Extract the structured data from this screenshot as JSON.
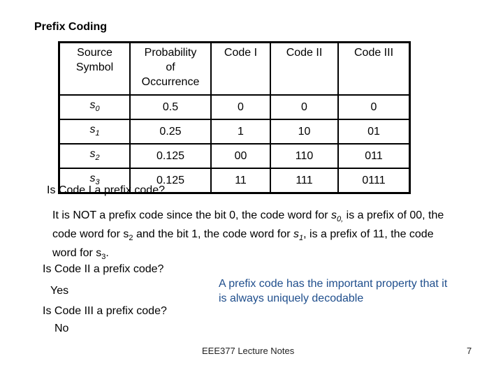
{
  "slide": {
    "title": "Prefix Coding",
    "table": {
      "headers": [
        [
          "Source",
          "Symbol"
        ],
        [
          "Probability",
          "of",
          "Occurrence"
        ],
        [
          "Code I"
        ],
        [
          "Code II"
        ],
        [
          "Code III"
        ]
      ],
      "rows": [
        {
          "symbol": "s",
          "sub": "0",
          "prob": "0.5",
          "code1": "0",
          "code2": "0",
          "code3": "0"
        },
        {
          "symbol": "s",
          "sub": "1",
          "prob": "0.25",
          "code1": "1",
          "code2": "10",
          "code3": "01"
        },
        {
          "symbol": "s",
          "sub": "2",
          "prob": "0.125",
          "code1": "00",
          "code2": "110",
          "code3": "011"
        },
        {
          "symbol": "s",
          "sub": "3",
          "prob": "0.125",
          "code1": "11",
          "code2": "111",
          "code3": "0111"
        }
      ]
    },
    "question1": "Is Code I a prefix code?",
    "answer1": {
      "p1": "It is NOT a prefix code since the bit 0, the code word for ",
      "s0": "s",
      "s0_sub": "0,",
      "p2": " is a prefix of 00, the code word for s",
      "s2_sub": "2",
      "p3": " and the bit 1, the code word for ",
      "s1": "s",
      "s1_sub": "1",
      "p4": ", is a prefix of 11, the code word for s",
      "s3_sub": "3",
      "p5": "."
    },
    "question2": "Is Code II a prefix code?",
    "answer2": "Yes",
    "question3": "Is Code III a prefix code?",
    "answer3": "No",
    "note": "A prefix code has the important property that it is always uniquely decodable",
    "note_color": "#1f4e8c",
    "footer": "EEE377 Lecture Notes",
    "page_number": "7"
  }
}
